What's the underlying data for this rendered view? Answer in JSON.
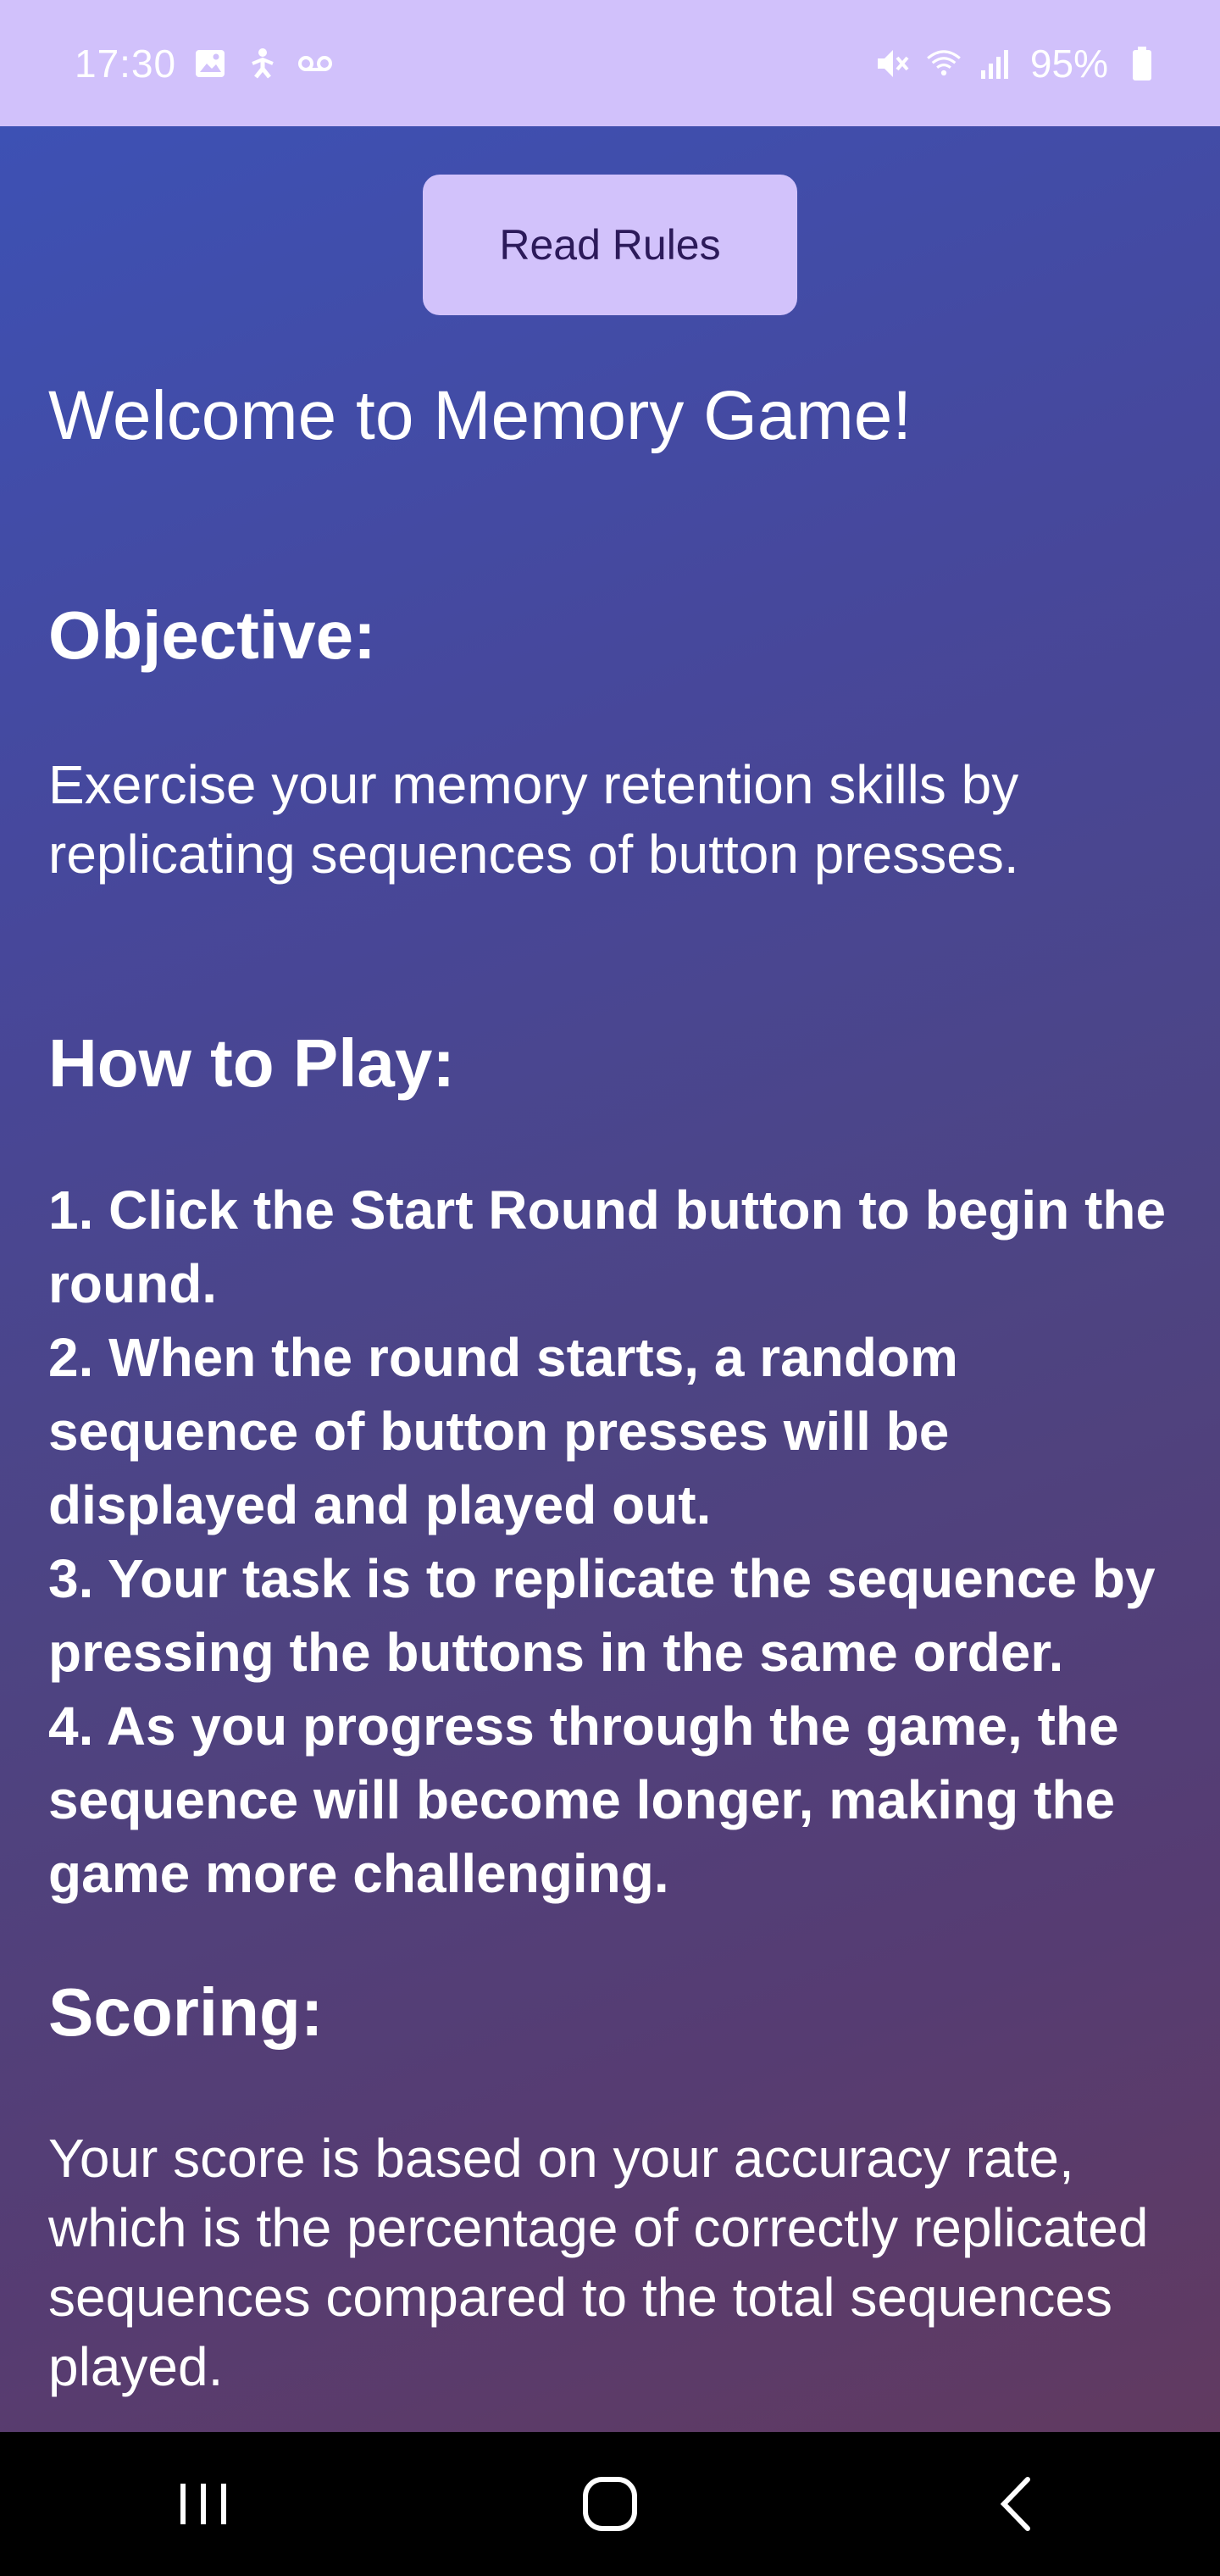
{
  "status_bar": {
    "time": "17:30",
    "left_icons": [
      "image-icon",
      "accessibility-icon",
      "voicemail-icon"
    ],
    "right_icons": [
      "mute-icon",
      "wifi-icon",
      "signal-icon"
    ],
    "battery_percent": "95%"
  },
  "header": {
    "read_rules_label": "Read Rules"
  },
  "content": {
    "title": "Welcome to Memory Game!",
    "objective_heading": "Objective:",
    "objective_text": "Exercise your memory retention skills by replicating sequences of button presses.",
    "howto_heading": "How to Play:",
    "steps": [
      "1. Click the Start Round button to begin the round.",
      "2. When the round starts, a random sequence of button presses will be displayed and played out.",
      "3. Your task is to replicate the sequence by pressing the buttons in the same order.",
      "4. As you progress through the game, the sequence will become longer, making the game more challenging."
    ],
    "scoring_heading": "Scoring:",
    "scoring_text": "Your score is based on your accuracy rate, which is the percentage of correctly replicated sequences compared to the total sequences played."
  },
  "nav_bar": {
    "icons": [
      "recent-apps-icon",
      "home-icon",
      "back-icon"
    ]
  },
  "colors": {
    "status_bar_bg": "#d1c1fb",
    "button_bg": "#d2c2fb",
    "button_text": "#2c1a5a",
    "gradient_top": "#3d51b4",
    "gradient_bottom": "#613a60"
  }
}
